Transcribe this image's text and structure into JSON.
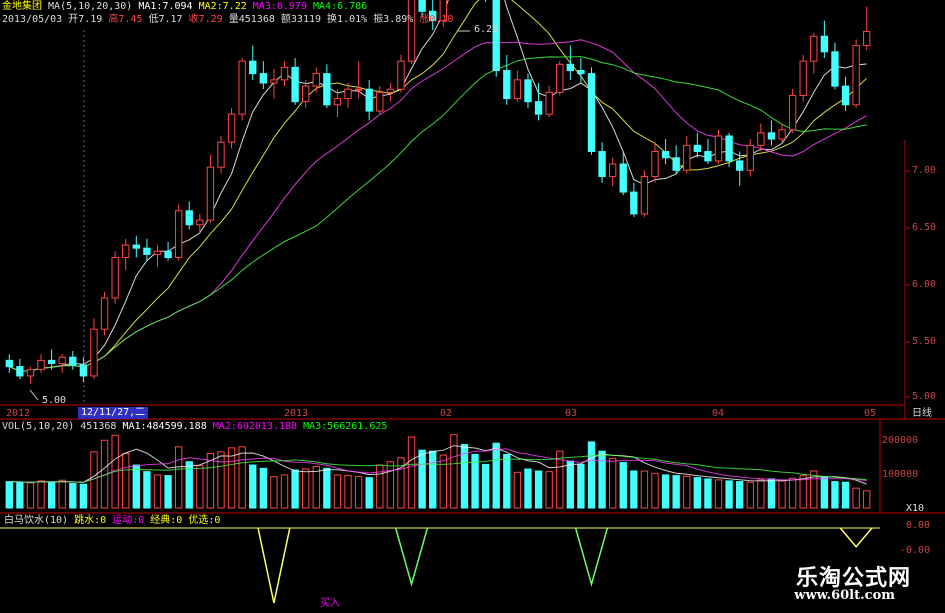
{
  "header": {
    "stock_name": "金地集团",
    "ma_label": "MA(5,10,20,30)",
    "ma1": "MA1:7.094",
    "ma2": "MA2:7.22",
    "ma3": "MA3:6.979",
    "ma4": "MA4:6.786",
    "date": "2013/05/03",
    "open": "开7.19",
    "high": "高7.45",
    "low": "低7.17",
    "close": "收7.29",
    "volume": "量451368",
    "amount": "额33119",
    "turnover": "换1.01%",
    "amplitude": "振3.89%",
    "change": "涨0.10"
  },
  "price_axis": {
    "labels": [
      "7.00",
      "6.50",
      "6.00",
      "5.50",
      "5.00"
    ]
  },
  "date_axis": {
    "labels": [
      "2012",
      "2013",
      "02",
      "03",
      "04",
      "05"
    ],
    "cursor": "12/11/27,二",
    "period": "日线"
  },
  "annotations": {
    "max_price": "6.25",
    "min_price": "5.00"
  },
  "volume_panel": {
    "header": "VOL(5,10,20)",
    "vol": "451368",
    "ma1": "MA1:484599.188",
    "ma2": "MA2:602013.188",
    "ma3": "MA3:566261.625",
    "axis": [
      "200000",
      "100000"
    ],
    "unit": "X10"
  },
  "indicator_panel": {
    "header": "白马饮水(10)",
    "item1": "跳水:0",
    "item2": "运动:0",
    "item3": "经典:0",
    "item4": "优选:0",
    "axis": [
      "0.00",
      "-0.00"
    ]
  },
  "watermark": {
    "line1": "乐淘公式网",
    "line2": "www.60lt.com"
  },
  "colors": {
    "up": "#ff4444",
    "down": "#44ffff",
    "ma1": "#ffffff",
    "ma2": "#ffff44",
    "ma3": "#ff44ff",
    "ma4": "#44ff44",
    "axis": "#c00000"
  },
  "chart_data": {
    "type": "candlestick",
    "y_range": [
      4.9,
      7.3
    ],
    "candles": [
      [
        5.18,
        5.22,
        5.1,
        5.14
      ],
      [
        5.14,
        5.19,
        5.06,
        5.08
      ],
      [
        5.08,
        5.14,
        5.03,
        5.12
      ],
      [
        5.12,
        5.22,
        5.1,
        5.18
      ],
      [
        5.18,
        5.25,
        5.12,
        5.16
      ],
      [
        5.16,
        5.22,
        5.1,
        5.2
      ],
      [
        5.2,
        5.24,
        5.12,
        5.15
      ],
      [
        5.15,
        5.2,
        5.04,
        5.08
      ],
      [
        5.08,
        5.45,
        5.06,
        5.38
      ],
      [
        5.38,
        5.62,
        5.34,
        5.58
      ],
      [
        5.58,
        5.88,
        5.54,
        5.84
      ],
      [
        5.84,
        5.96,
        5.76,
        5.92
      ],
      [
        5.92,
        5.98,
        5.84,
        5.9
      ],
      [
        5.9,
        5.96,
        5.82,
        5.86
      ],
      [
        5.86,
        5.92,
        5.78,
        5.88
      ],
      [
        5.88,
        5.94,
        5.82,
        5.84
      ],
      [
        5.84,
        6.18,
        5.82,
        6.14
      ],
      [
        6.14,
        6.2,
        6.02,
        6.05
      ],
      [
        6.05,
        6.12,
        6.0,
        6.08
      ],
      [
        6.08,
        6.5,
        6.06,
        6.42
      ],
      [
        6.42,
        6.62,
        6.38,
        6.58
      ],
      [
        6.58,
        6.8,
        6.54,
        6.76
      ],
      [
        6.76,
        7.12,
        6.72,
        7.1
      ],
      [
        7.1,
        7.2,
        6.98,
        7.02
      ],
      [
        7.02,
        7.1,
        6.92,
        6.96
      ],
      [
        6.96,
        7.05,
        6.86,
        6.98
      ],
      [
        6.98,
        7.1,
        6.94,
        7.06
      ],
      [
        7.06,
        7.12,
        6.82,
        6.84
      ],
      [
        6.84,
        6.98,
        6.8,
        6.94
      ],
      [
        6.94,
        7.06,
        6.9,
        7.02
      ],
      [
        7.02,
        7.08,
        6.8,
        6.82
      ],
      [
        6.82,
        6.92,
        6.74,
        6.86
      ],
      [
        6.86,
        6.96,
        6.8,
        6.92
      ],
      [
        6.92,
        7.1,
        6.86,
        6.92
      ],
      [
        6.92,
        6.98,
        6.72,
        6.78
      ],
      [
        6.78,
        6.94,
        6.76,
        6.9
      ],
      [
        6.9,
        6.96,
        6.84,
        6.92
      ],
      [
        6.92,
        7.14,
        6.9,
        7.1
      ],
      [
        7.1,
        7.62,
        7.08,
        7.56
      ],
      [
        7.56,
        7.78,
        7.38,
        7.42
      ],
      [
        7.42,
        7.6,
        7.3,
        7.36
      ],
      [
        7.36,
        7.64,
        7.32,
        7.58
      ],
      [
        7.58,
        8.1,
        7.54,
        8.05
      ],
      [
        8.05,
        8.25,
        7.88,
        7.95
      ],
      [
        7.95,
        8.02,
        7.82,
        7.86
      ],
      [
        7.86,
        7.94,
        7.48,
        7.52
      ],
      [
        7.52,
        7.6,
        7.0,
        7.04
      ],
      [
        7.04,
        7.14,
        6.82,
        6.86
      ],
      [
        6.86,
        7.04,
        6.84,
        6.98
      ],
      [
        6.98,
        7.02,
        6.8,
        6.84
      ],
      [
        6.84,
        6.96,
        6.72,
        6.76
      ],
      [
        6.76,
        6.94,
        6.74,
        6.9
      ],
      [
        6.9,
        7.1,
        6.88,
        7.08
      ],
      [
        7.08,
        7.2,
        6.98,
        7.04
      ],
      [
        7.04,
        7.12,
        6.96,
        7.02
      ],
      [
        7.02,
        7.06,
        6.5,
        6.52
      ],
      [
        6.52,
        6.58,
        6.32,
        6.36
      ],
      [
        6.36,
        6.48,
        6.3,
        6.44
      ],
      [
        6.44,
        6.52,
        6.24,
        6.26
      ],
      [
        6.26,
        6.32,
        6.1,
        6.12
      ],
      [
        6.12,
        6.4,
        6.1,
        6.36
      ],
      [
        6.36,
        6.58,
        6.32,
        6.52
      ],
      [
        6.52,
        6.6,
        6.44,
        6.48
      ],
      [
        6.48,
        6.56,
        6.38,
        6.4
      ],
      [
        6.4,
        6.62,
        6.38,
        6.56
      ],
      [
        6.56,
        6.64,
        6.48,
        6.52
      ],
      [
        6.52,
        6.6,
        6.44,
        6.46
      ],
      [
        6.46,
        6.66,
        6.44,
        6.62
      ],
      [
        6.62,
        6.64,
        6.42,
        6.46
      ],
      [
        6.46,
        6.52,
        6.3,
        6.4
      ],
      [
        6.4,
        6.6,
        6.36,
        6.56
      ],
      [
        6.56,
        6.7,
        6.52,
        6.64
      ],
      [
        6.64,
        6.72,
        6.56,
        6.6
      ],
      [
        6.6,
        6.7,
        6.58,
        6.66
      ],
      [
        6.66,
        6.92,
        6.64,
        6.88
      ],
      [
        6.88,
        7.14,
        6.84,
        7.1
      ],
      [
        7.1,
        7.28,
        7.02,
        7.26
      ],
      [
        7.26,
        7.36,
        7.12,
        7.16
      ],
      [
        7.16,
        7.22,
        6.92,
        6.94
      ],
      [
        6.94,
        7.0,
        6.78,
        6.82
      ],
      [
        6.82,
        7.24,
        6.8,
        7.2
      ],
      [
        7.2,
        7.45,
        7.17,
        7.29
      ]
    ],
    "volume_scale": [
      0,
      230000
    ],
    "volume": [
      80000,
      78000,
      76000,
      82000,
      79000,
      84000,
      74000,
      72000,
      170000,
      205000,
      220000,
      165000,
      130000,
      110000,
      100000,
      98000,
      185000,
      140000,
      128000,
      165000,
      170000,
      182000,
      185000,
      130000,
      120000,
      95000,
      100000,
      115000,
      118000,
      126000,
      120000,
      100000,
      98000,
      95000,
      92000,
      130000,
      140000,
      152000,
      215000,
      175000,
      172000,
      160000,
      222000,
      192000,
      162000,
      132000,
      196000,
      162000,
      108000,
      118000,
      112000,
      110000,
      172000,
      142000,
      132000,
      200000,
      172000,
      150000,
      138000,
      112000,
      112000,
      105000,
      100000,
      98000,
      96000,
      92000,
      88000,
      85000,
      82000,
      80000,
      78000,
      85000,
      88000,
      82000,
      90000,
      98000,
      112000,
      92000,
      80000,
      78000,
      60000,
      52000
    ],
    "indicator_spikes": [
      {
        "index": 25,
        "depth": 1.0,
        "color": "#ffff66"
      },
      {
        "index": 38,
        "depth": 0.75,
        "color": "#66ff66"
      },
      {
        "index": 55,
        "depth": 0.75,
        "color": "#66ff66"
      },
      {
        "index": 80,
        "depth": 0.25,
        "color": "#ffff66"
      }
    ],
    "indicator_spike_label": "买入"
  }
}
